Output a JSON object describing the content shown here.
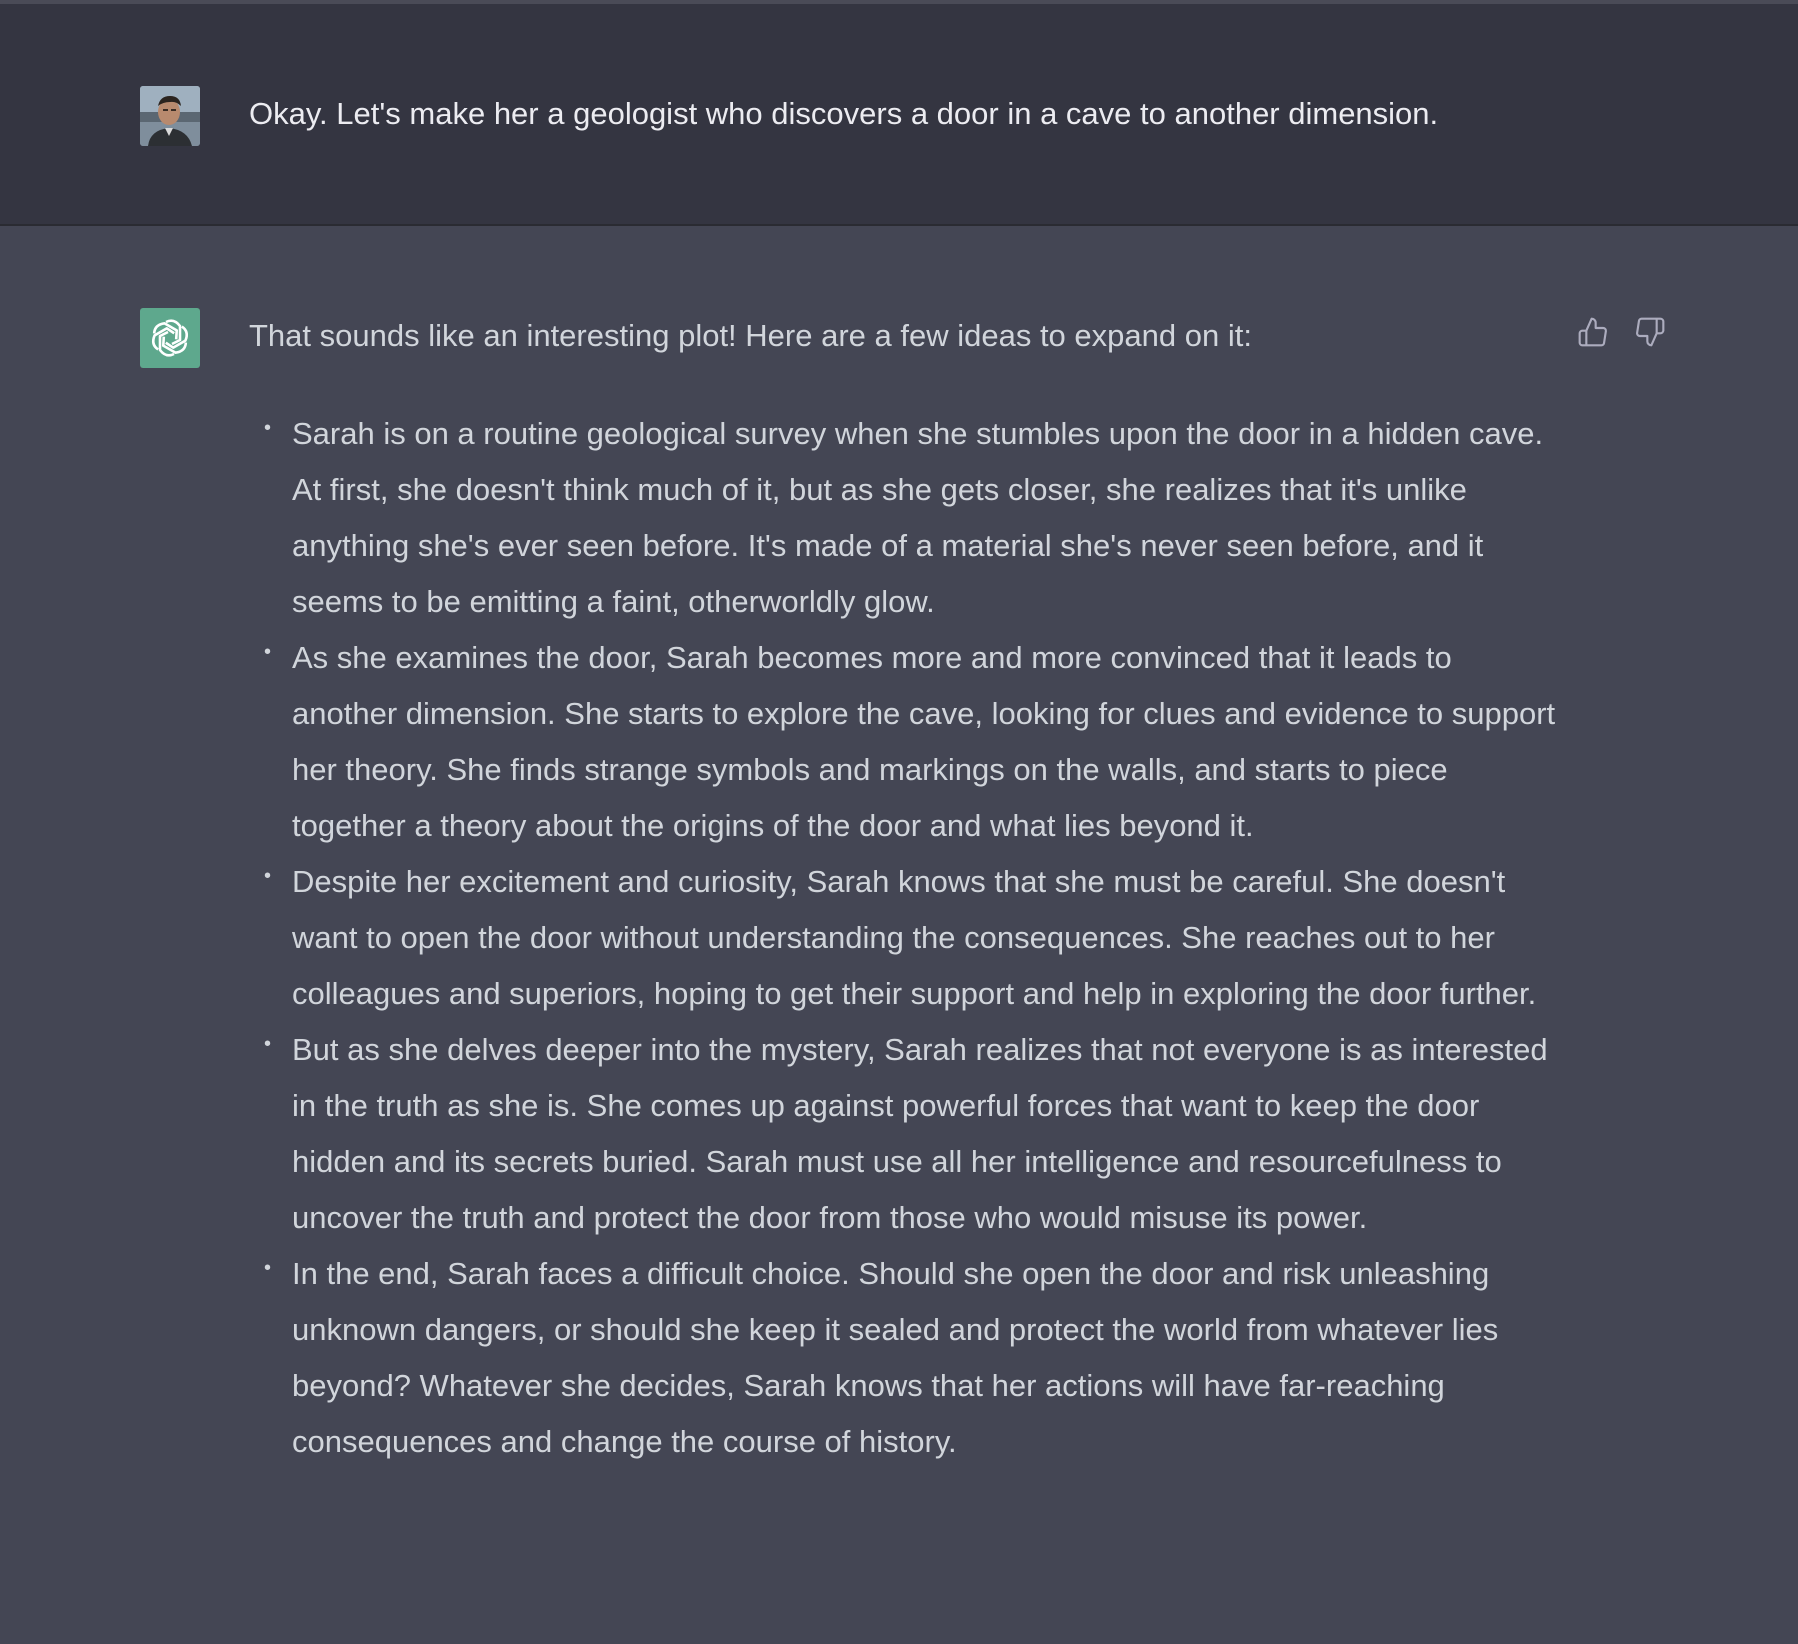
{
  "user_message": {
    "avatar_icon": "user-photo-avatar",
    "text": "Okay. Let's make her a geologist who discovers a door in a cave to another dimension."
  },
  "assistant_message": {
    "avatar_icon": "openai-logo-icon",
    "avatar_color": "#5ea88d",
    "intro": "That sounds like an interesting plot! Here are a few ideas to expand on it:",
    "ideas": [
      "Sarah is on a routine geological survey when she stumbles upon the door in a hidden cave. At first, she doesn't think much of it, but as she gets closer, she realizes that it's unlike anything she's ever seen before. It's made of a material she's never seen before, and it seems to be emitting a faint, otherworldly glow.",
      "As she examines the door, Sarah becomes more and more convinced that it leads to another dimension. She starts to explore the cave, looking for clues and evidence to support her theory. She finds strange symbols and markings on the walls, and starts to piece together a theory about the origins of the door and what lies beyond it.",
      "Despite her excitement and curiosity, Sarah knows that she must be careful. She doesn't want to open the door without understanding the consequences. She reaches out to her colleagues and superiors, hoping to get their support and help in exploring the door further.",
      "But as she delves deeper into the mystery, Sarah realizes that not everyone is as interested in the truth as she is. She comes up against powerful forces that want to keep the door hidden and its secrets buried. Sarah must use all her intelligence and resourcefulness to uncover the truth and protect the door from those who would misuse its power.",
      "In the end, Sarah faces a difficult choice. Should she open the door and risk unleashing unknown dangers, or should she keep it sealed and protect the world from whatever lies beyond? Whatever she decides, Sarah knows that her actions will have far-reaching consequences and change the course of history."
    ],
    "bullet_glyph": "•",
    "feedback": {
      "thumbs_up_icon": "thumbs-up-icon",
      "thumbs_down_icon": "thumbs-down-icon"
    }
  },
  "colors": {
    "user_turn_bg": "#343541",
    "assistant_turn_bg": "#444654",
    "user_text": "#ececf1",
    "assistant_text": "#d1d5db",
    "icon": "#acacbe"
  }
}
